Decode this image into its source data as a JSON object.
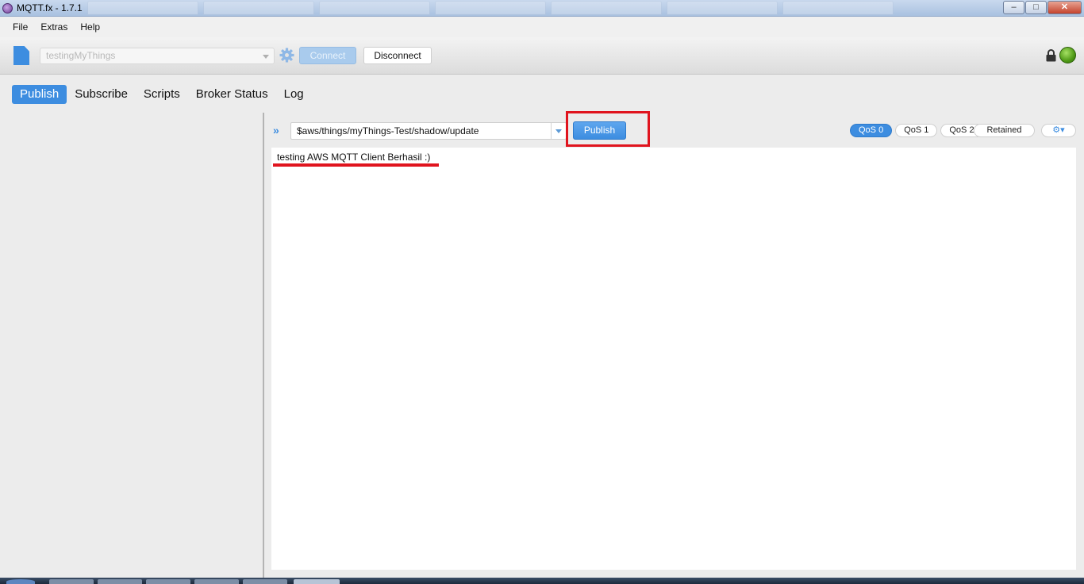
{
  "window": {
    "title": "MQTT.fx - 1.7.1",
    "minimize": "‒",
    "maximize": "□",
    "close": "✕"
  },
  "menu": {
    "items": [
      "File",
      "Extras",
      "Help"
    ]
  },
  "toolbar": {
    "profile_value": "testingMyThings",
    "connect_label": "Connect",
    "disconnect_label": "Disconnect",
    "connection_status_color": "#4f9a16"
  },
  "tabs": [
    {
      "label": "Publish",
      "active": true
    },
    {
      "label": "Subscribe",
      "active": false
    },
    {
      "label": "Scripts",
      "active": false
    },
    {
      "label": "Broker Status",
      "active": false
    },
    {
      "label": "Log",
      "active": false
    }
  ],
  "publish": {
    "expand_icon": "»",
    "topic": "$aws/things/myThings-Test/shadow/update",
    "publish_label": "Publish",
    "qos": [
      {
        "label": "QoS 0",
        "active": true
      },
      {
        "label": "QoS 1",
        "active": false
      },
      {
        "label": "QoS 2",
        "active": false
      }
    ],
    "retained_label": "Retained",
    "options_icon": "⚙▾",
    "payload": "testing AWS MQTT Client Berhasil :)"
  },
  "colors": {
    "accent": "#3d8de0",
    "annotation": "#e0141e"
  }
}
